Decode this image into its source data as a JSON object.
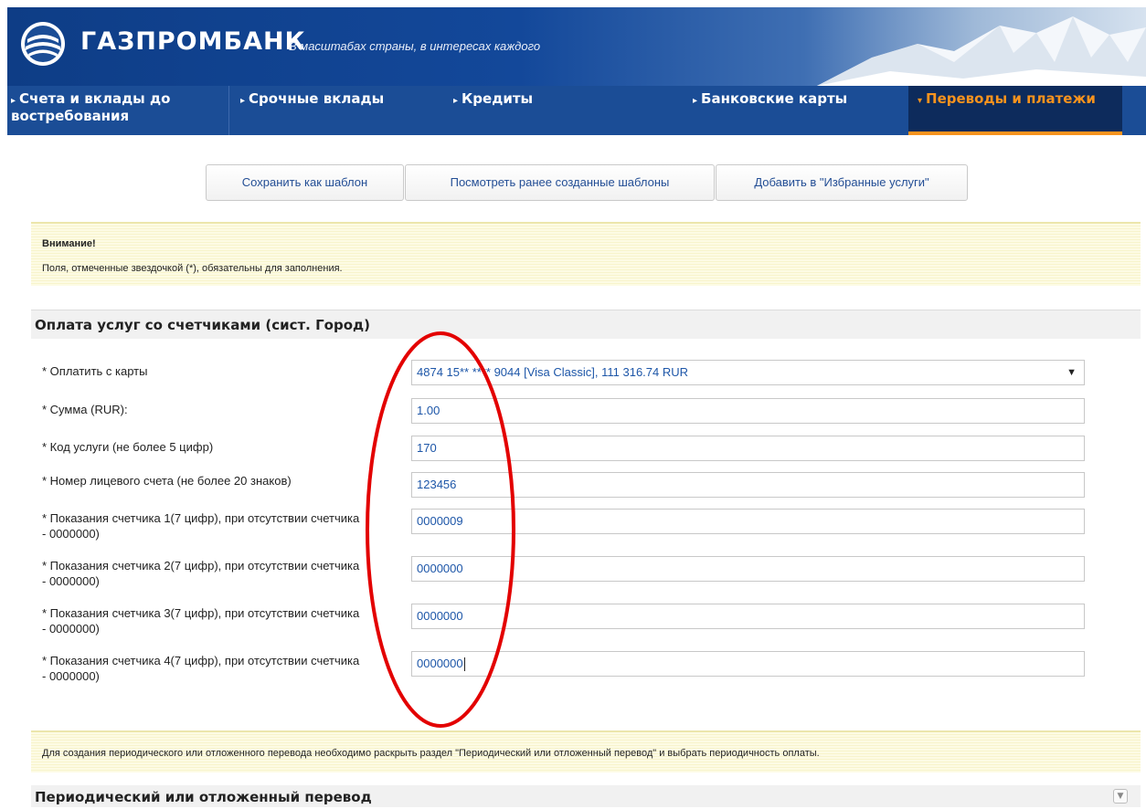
{
  "header": {
    "brand": "ГАЗПРОМБАНК",
    "slogan": "В масштабах страны, в интересах каждого",
    "nav": [
      {
        "label": "Счета и вклады до востребования"
      },
      {
        "label": "Срочные вклады"
      },
      {
        "label": "Кредиты"
      },
      {
        "label": "Банковские карты"
      },
      {
        "label": "Переводы и платежи",
        "active": true
      }
    ]
  },
  "toolbar": {
    "save_template": "Сохранить как шаблон",
    "view_templates": "Посмотреть ранее созданные шаблоны",
    "add_favorite": "Добавить в \"Избранные услуги\""
  },
  "notice": {
    "title": "Внимание!",
    "text": "Поля, отмеченные звездочкой (*), обязательны для заполнения."
  },
  "section": {
    "title": "Оплата услуг со счетчиками (сист. Город)"
  },
  "form": {
    "card": {
      "label": "* Оплатить с карты",
      "value": "4874 15** **** 9044 [Visa Classic], 111 316.74 RUR"
    },
    "fields": [
      {
        "label": "* Сумма (RUR):",
        "value": "1.00"
      },
      {
        "label": "* Код услуги (не более 5 цифр)",
        "value": "170"
      },
      {
        "label": "* Номер лицевого счета (не более 20 знаков)",
        "value": "123456"
      },
      {
        "label": "* Показания счетчика 1(7 цифр), при отсутствии счетчика - 0000000)",
        "value": "0000009"
      },
      {
        "label": "* Показания счетчика 2(7 цифр), при отсутствии счетчика - 0000000)",
        "value": "0000000"
      },
      {
        "label": "* Показания счетчика 3(7 цифр), при отсутствии счетчика - 0000000)",
        "value": "0000000"
      },
      {
        "label": "* Показания счетчика 4(7 цифр), при отсутствии счетчика - 0000000)",
        "value": "0000000"
      }
    ]
  },
  "periodic": {
    "notice": "Для создания периодического или отложенного перевода необходимо раскрыть раздел \"Периодический или отложенный перевод\" и выбрать периодичность оплаты.",
    "title": "Периодический или отложенный перевод"
  },
  "colors": {
    "brand_blue": "#1b4d96",
    "active_orange": "#f7931e",
    "annotation_red": "#e30000"
  }
}
